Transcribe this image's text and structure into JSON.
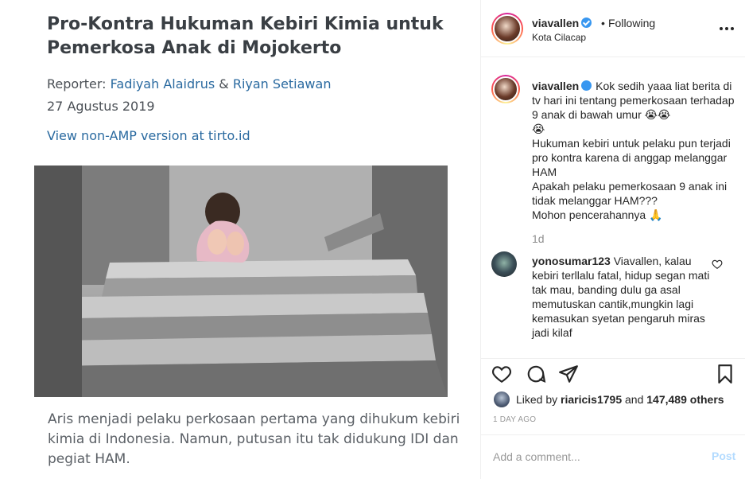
{
  "article": {
    "title": "Pro-Kontra Hukuman Kebiri Kimia untuk Pemerkosa Anak di Mojokerto",
    "reporter_label": "Reporter:",
    "reporter_1": "Fadiyah Alaidrus",
    "amp": "&",
    "reporter_2": "Riyan Setiawan",
    "date": "27 Agustus 2019",
    "link_text": "View non-AMP version at tirto.id",
    "caption": "Aris menjadi pelaku perkosaan pertama yang dihukum kebiri kimia di Indonesia. Namun, putusan itu tak didukung IDI dan pegiat HAM."
  },
  "header": {
    "username": "viavallen",
    "dot": "•",
    "follow_label": "Following",
    "location": "Kota Cilacap",
    "more_icon": "more-horizontal-icon"
  },
  "caption": {
    "username": "viavallen",
    "text": "Kok sedih yaaa liat berita di tv hari ini tentang pemerkosaan terhadap 9 anak di bawah umur 😭😭\n😭\nHukuman kebiri untuk pelaku pun terjadi pro kontra karena di anggap melanggar HAM\nApakah pelaku pemerkosaan 9 anak ini tidak melanggar HAM???\nMohon pencerahannya 🙏",
    "time": "1d"
  },
  "comment": {
    "username": "yonosumar123",
    "text": "Viavallen, kalau kebiri terllalu fatal, hidup segan mati tak mau, banding dulu ga asal memutuskan cantik,mungkin lagi kemasukan syetan pengaruh miras jadi kilaf"
  },
  "likes": {
    "prefix": "Liked by",
    "user": "riaricis1795",
    "middle": "and",
    "count": "147,489 others"
  },
  "timestamp": "1 DAY AGO",
  "add_comment": {
    "placeholder": "Add a comment...",
    "post_label": "Post"
  },
  "colors": {
    "verified": "#3897f0",
    "link": "#2a6aa0",
    "post_button": "#b3dbff"
  }
}
